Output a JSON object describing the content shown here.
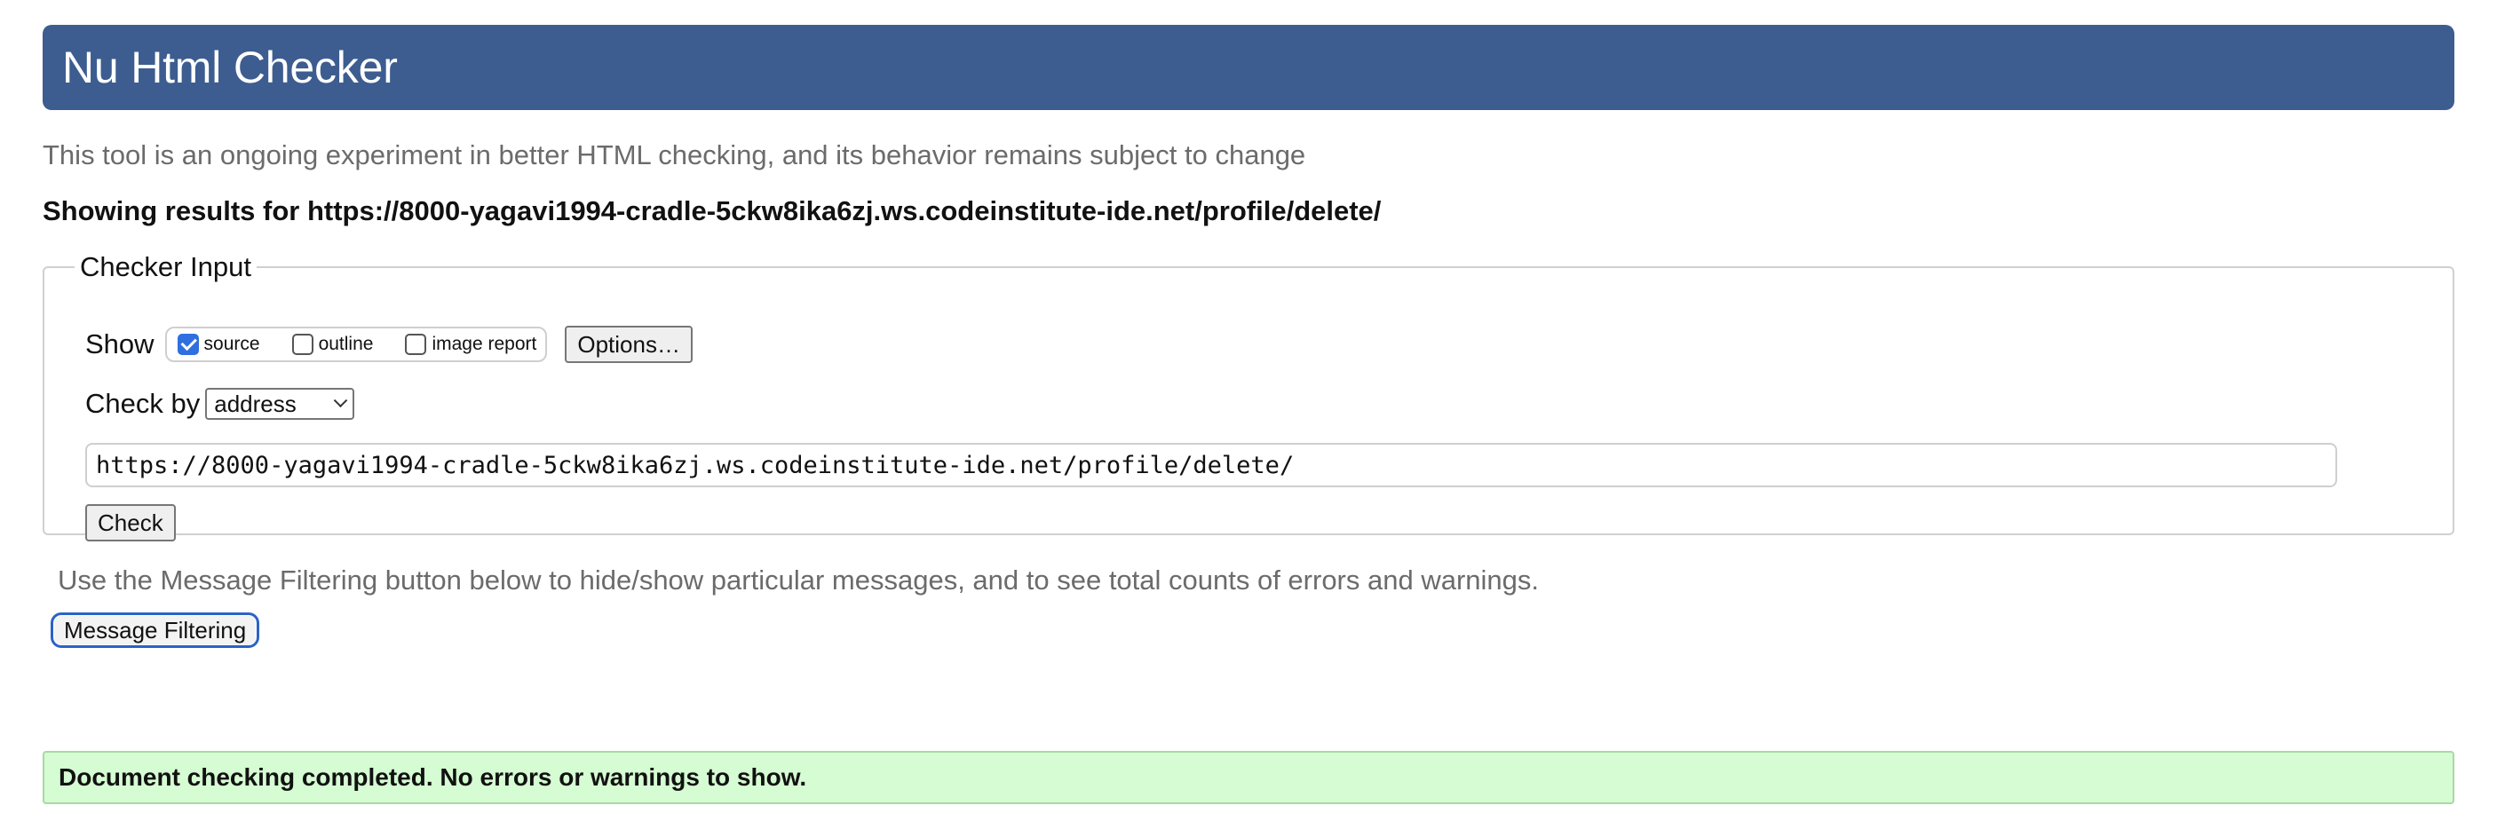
{
  "header": {
    "title": "Nu Html Checker"
  },
  "intro_text": "This tool is an ongoing experiment in better HTML checking, and its behavior remains subject to change",
  "showing": {
    "prefix": "Showing results for ",
    "url": "https://8000-yagavi1994-cradle-5ckw8ika6zj.ws.codeinstitute-ide.net/profile/delete/"
  },
  "checker_input": {
    "legend": "Checker Input",
    "show_label": "Show",
    "show_options": [
      {
        "label": "source",
        "checked": true
      },
      {
        "label": "outline",
        "checked": false
      },
      {
        "label": "image report",
        "checked": false
      }
    ],
    "options_button": "Options…",
    "check_by_label": "Check by",
    "check_by_selected": "address",
    "url_value": "https://8000-yagavi1994-cradle-5ckw8ika6zj.ws.codeinstitute-ide.net/profile/delete/",
    "check_button": "Check"
  },
  "filter": {
    "note": "Use the Message Filtering button below to hide/show particular messages, and to see total counts of errors and warnings.",
    "button": "Message Filtering"
  },
  "result": {
    "message": "Document checking completed. No errors or warnings to show."
  },
  "colors": {
    "banner": "#3d5d90",
    "success_bg": "#d5fcd2",
    "focus_ring": "#2a62c8"
  }
}
